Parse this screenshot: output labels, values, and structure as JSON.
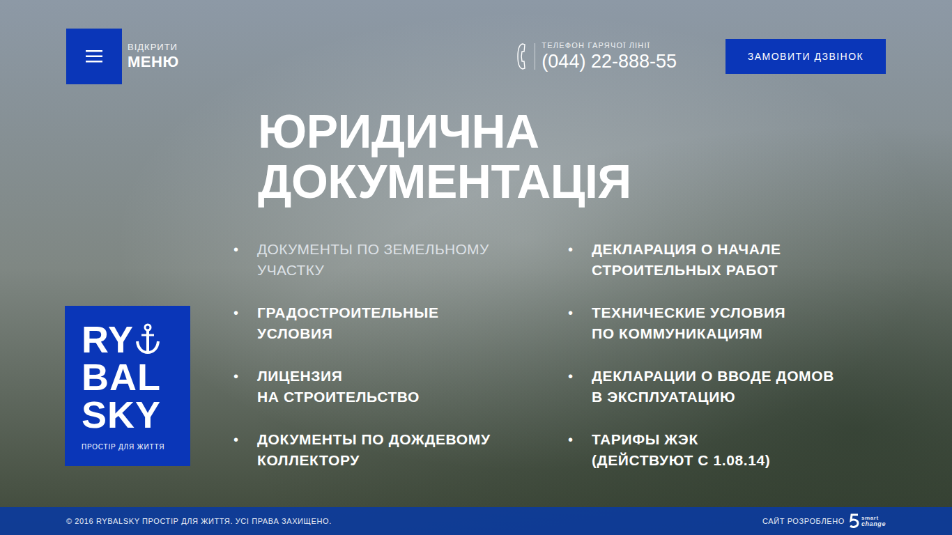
{
  "menu_button": {
    "label_top": "ВІДКРИТИ",
    "label_bottom": "МЕНЮ"
  },
  "hotline": {
    "label": "ТЕЛЕФОН ГАРЯЧОЇ ЛІНІЇ",
    "phone": "(044) 22-888-55"
  },
  "call_button": "ЗАМОВИТИ ДЗВІНОК",
  "heading": [
    "ЮРИДИЧНА",
    "ДОКУМЕНТАЦІЯ"
  ],
  "logo": {
    "lines": [
      "RY",
      "BAL",
      "SKY"
    ],
    "tagline": "ПРОСТІР ДЛЯ ЖИТТЯ"
  },
  "bullet": "•",
  "documents": [
    [
      {
        "lines": [
          "ДОКУМЕНТЫ ПО ЗЕМЕЛЬНОМУ",
          "УЧАСТКУ"
        ],
        "hovered": true
      },
      {
        "lines": [
          "ГРАДОСТРОИТЕЛЬНЫЕ",
          "УСЛОВИЯ"
        ],
        "hovered": false
      },
      {
        "lines": [
          "ЛИЦЕНЗИЯ",
          "НА СТРОИТЕЛЬСТВО"
        ],
        "hovered": false
      },
      {
        "lines": [
          "ДОКУМЕНТЫ ПО ДОЖДЕВОМУ",
          "КОЛЛЕКТОРУ"
        ],
        "hovered": false
      }
    ],
    [
      {
        "lines": [
          "ДЕКЛАРАЦИЯ О НАЧАЛЕ",
          "СТРОИТЕЛЬНЫХ РАБОТ"
        ],
        "hovered": false
      },
      {
        "lines": [
          "ТЕХНИЧЕСКИЕ УСЛОВИЯ",
          "ПО КОММУНИКАЦИЯМ"
        ],
        "hovered": false
      },
      {
        "lines": [
          "ДЕКЛАРАЦИИ О ВВОДЕ ДОМОВ",
          "В ЭКСПЛУАТАЦИЮ"
        ],
        "hovered": false
      },
      {
        "lines": [
          "ТАРИФЫ ЖЭК",
          "(ДЕЙСТВУЮТ С 1.08.14)"
        ],
        "hovered": false
      }
    ]
  ],
  "footer": {
    "copyright": "© 2016 RYBALSKY ПРОСТІР ДЛЯ ЖИТТЯ. УСІ ПРАВА ЗАХИЩЕНО.",
    "credit": "САЙТ РОЗРОБЛЕНО",
    "developer": {
      "top": "smart",
      "bottom": "change"
    }
  }
}
